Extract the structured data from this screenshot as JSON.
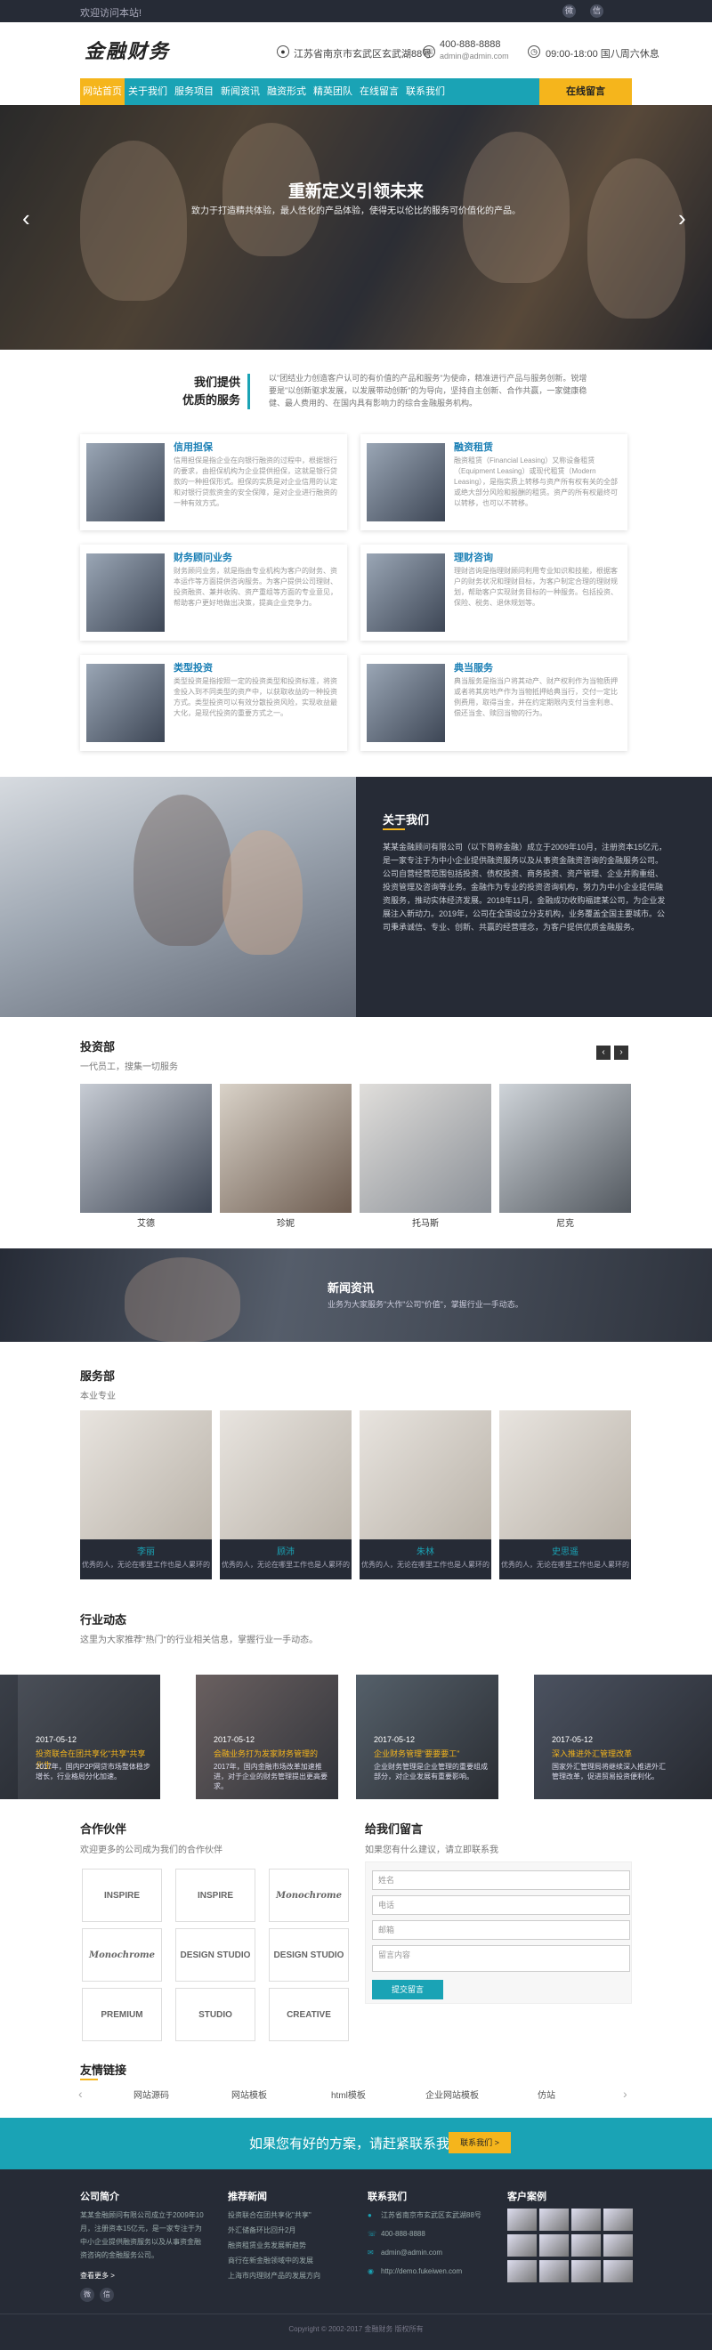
{
  "topbar": {
    "welcome": "欢迎访问本站!"
  },
  "header": {
    "logo": "金融财务",
    "address": "江苏省南京市玄武区玄武湖88号",
    "phone": "400-888-8888",
    "email": "admin@admin.com",
    "hours": "09:00-18:00 国八周六休息"
  },
  "nav": {
    "items": [
      "网站首页",
      "关于我们",
      "服务项目",
      "新闻资讯",
      "融资形式",
      "精英团队",
      "在线留言",
      "联系我们"
    ],
    "hot": "在线留言"
  },
  "banner": {
    "title": "重新定义引领未来",
    "subtitle": "致力于打造精共体验，最人性化的产品体验，使得无以伦比的服务可价值化的产品。"
  },
  "services": {
    "title": "我们提供\n优质的服务",
    "intro": "以\"团结业力创造客户认可的有价值的产品和服务\"为使命，精准进行产品与服务创新。锐增要是\"以创新驱求发展，以发展带动创新\"的为导向，坚持自主创新、合作共赢，一家健康稳健、最人费用的、在国内具有影响力的综合金融服务机构。",
    "items": [
      {
        "title": "信用担保",
        "desc": "信用担保是指企业在向银行融资的过程中，根据银行的要求，由担保机构为企业提供担保，这就是银行贷款的一种担保形式。担保的实质是对企业信用的认定和对银行贷款资金的安全保障，是对企业进行融资的一种有效方式。"
      },
      {
        "title": "融资租赁",
        "desc": "融资租赁（Financial Leasing）又称设备租赁（Equipment Leasing）或现代租赁（Modern Leasing），是指实质上转移与资产所有权有关的全部或绝大部分风险和报酬的租赁。资产的所有权最终可以转移，也可以不转移。"
      },
      {
        "title": "财务顾问业务",
        "desc": "财务顾问业务，就是指由专业机构为客户的财务、资本运作等方面提供咨询服务。为客户提供公司理财、投资融资、兼并收购、资产重组等方面的专业意见，帮助客户更好地做出决策，提高企业竞争力。"
      },
      {
        "title": "理财咨询",
        "desc": "理财咨询是指理财顾问利用专业知识和技能，根据客户的财务状况和理财目标，为客户制定合理的理财规划，帮助客户实现财务目标的一种服务。包括投资、保险、税务、退休规划等。"
      },
      {
        "title": "类型投资",
        "desc": "类型投资是指按照一定的投资类型和投资标准，将资金投入到不同类型的资产中，以获取收益的一种投资方式。类型投资可以有效分散投资风险，实现收益最大化，是现代投资的重要方式之一。"
      },
      {
        "title": "典当服务",
        "desc": "典当服务是指当户将其动产、财产权利作为当物质押或者将其房地产作为当物抵押给典当行，交付一定比例费用，取得当金，并在约定期限内支付当金利息、偿还当金、赎回当物的行为。"
      }
    ]
  },
  "about": {
    "title": "关于我们",
    "desc": "某某金融顾问有限公司（以下简称金融）成立于2009年10月，注册资本15亿元，是一家专注于为中小企业提供融资服务以及从事资金融资咨询的金融服务公司。公司自营经营范围包括投资、债权投资、商务投资、资产管理、企业并购重组、投资管理及咨询等业务。金融作为专业的投资咨询机构，努力为中小企业提供融资服务，推动实体经济发展。2018年11月，金融成功收购福建某公司，为企业发展注入新动力。2019年，公司在全国设立分支机构，业务覆盖全国主要城市。公司秉承诚信、专业、创新、共赢的经营理念，为客户提供优质金融服务。"
  },
  "investment": {
    "title": "投资部",
    "sub": "一代员工，搜集一切服务",
    "items": [
      "艾德",
      "珍妮",
      "托马斯",
      "尼克"
    ]
  },
  "news": {
    "title": "新闻资讯",
    "sub": "业务为大家服务\"大作\"公司\"价值\"，掌握行业一手动态。"
  },
  "department": {
    "title": "服务部",
    "sub": "本业专业",
    "items": [
      {
        "name": "李丽",
        "desc": "优秀的人，无论在哪里工作也是人累环的"
      },
      {
        "name": "顾沛",
        "desc": "优秀的人，无论在哪里工作也是人累环的"
      },
      {
        "name": "朱林",
        "desc": "优秀的人，无论在哪里工作也是人累环的"
      },
      {
        "name": "史思遥",
        "desc": "优秀的人，无论在哪里工作也是人累环的"
      }
    ]
  },
  "industry": {
    "title": "行业动态",
    "sub": "这里为大家推荐\"热门\"的行业相关信息，掌握行业一手动态。",
    "items": [
      {
        "date": "2017-05-12",
        "title": "投资联合在团共享化\"共享\"共享化生",
        "desc": "2017年，国内P2P网贷市场整体稳步增长，行业格局分化加速。"
      },
      {
        "date": "2017-05-12",
        "title": "会融业务打为发家财务管理的",
        "desc": "2017年，国内金融市场改革加速推进，对于企业的财务管理提出更高要求。"
      },
      {
        "date": "2017-05-12",
        "title": "企业财务管理\"要要要工\"",
        "desc": "企业财务管理是企业管理的重要组成部分，对企业发展有重要影响。"
      },
      {
        "date": "2017-05-12",
        "title": "深入推进外汇管理改革",
        "desc": "国家外汇管理局将继续深入推进外汇管理改革，促进贸易投资便利化。"
      }
    ]
  },
  "partners": {
    "title": "合作伙伴",
    "sub": "欢迎更多的公司成为我们的合作伙伴",
    "logos": [
      "INSPIRE",
      "INSPIRE",
      "Monochrome",
      "Monochrome",
      "DESIGN STUDIO",
      "DESIGN STUDIO",
      "PREMIUM",
      "STUDIO",
      "CREATIVE"
    ]
  },
  "message": {
    "title": "给我们留言",
    "sub": "如果您有什么建议，请立即联系我",
    "fields": [
      "姓名",
      "电话",
      "邮箱",
      "留言内容"
    ],
    "submit": "提交留言"
  },
  "links": {
    "title": "友情链接",
    "items": [
      "网站源码",
      "网站模板",
      "html模板",
      "企业网站模板",
      "仿站"
    ]
  },
  "cta": {
    "text": "如果您有好的方案，请赶紧联系我们",
    "button": "联系我们 >"
  },
  "footer": {
    "about_title": "公司简介",
    "about_text": "某某金融顾问有限公司成立于2009年10月，注册资本15亿元，是一家专注于为中小企业提供融资服务以及从事资金融资咨询的金融服务公司。",
    "more": "查看更多 >",
    "news_title": "推荐新闻",
    "news": [
      "投资联合在团共享化\"共享\"",
      "外汇储备环比回升2月",
      "融资租赁业务发展新趋势",
      "商行在新金融领域中的发展",
      "上海市内理财产品的发展方向"
    ],
    "contact_title": "联系我们",
    "contact": [
      "江苏省南京市玄武区玄武湖88号",
      "400-888-8888",
      "admin@admin.com",
      "http://demo.fukeiwen.com"
    ],
    "cases_title": "客户案例",
    "copyright": "Copyright © 2002-2017 金融财务 版权所有"
  }
}
